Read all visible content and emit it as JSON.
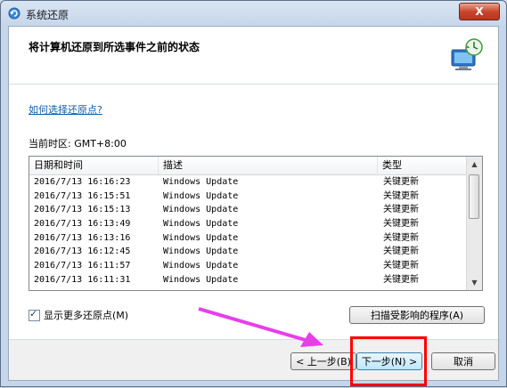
{
  "window": {
    "title": "系统还原",
    "close_label": "X"
  },
  "header": {
    "heading": "将计算机还原到所选事件之前的状态",
    "icon": "system-restore-icon"
  },
  "help_link": "如何选择还原点?",
  "timezone": "当前时区: GMT+8:00",
  "table": {
    "columns": [
      "日期和时间",
      "描述",
      "类型"
    ],
    "rows": [
      {
        "datetime": "2016/7/13 16:16:23",
        "description": "Windows Update",
        "type": "关键更新"
      },
      {
        "datetime": "2016/7/13 16:15:51",
        "description": "Windows Update",
        "type": "关键更新"
      },
      {
        "datetime": "2016/7/13 16:15:13",
        "description": "Windows Update",
        "type": "关键更新"
      },
      {
        "datetime": "2016/7/13 16:13:49",
        "description": "Windows Update",
        "type": "关键更新"
      },
      {
        "datetime": "2016/7/13 16:13:16",
        "description": "Windows Update",
        "type": "关键更新"
      },
      {
        "datetime": "2016/7/13 16:12:45",
        "description": "Windows Update",
        "type": "关键更新"
      },
      {
        "datetime": "2016/7/13 16:11:57",
        "description": "Windows Update",
        "type": "关键更新"
      },
      {
        "datetime": "2016/7/13 16:11:31",
        "description": "Windows Update",
        "type": "关键更新"
      }
    ]
  },
  "show_more": {
    "label": "显示更多还原点(M)",
    "checked": true
  },
  "buttons": {
    "scan": "扫描受影响的程序(A)",
    "back": "< 上一步(B)",
    "next": "下一步(N) >",
    "cancel": "取消"
  },
  "annotation": {
    "arrow_color": "#e83ee8",
    "highlight_color": "#ff0000"
  }
}
